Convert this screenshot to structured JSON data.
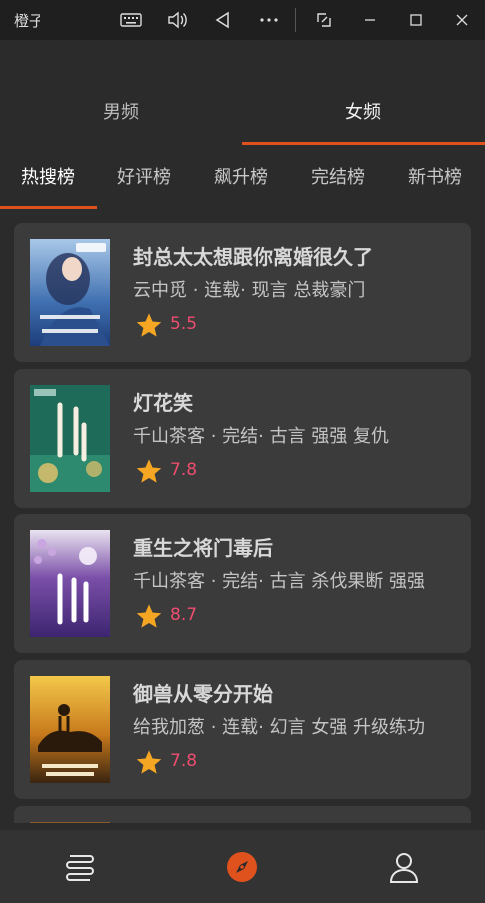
{
  "window": {
    "title": "橙子"
  },
  "titlebar_icons": [
    "keyboard-icon",
    "volume-icon",
    "back-triangle-icon",
    "more-icon",
    "screenshot-icon",
    "minimize-icon",
    "maximize-icon",
    "close-icon"
  ],
  "top_tabs": [
    {
      "label": "男频",
      "active": false
    },
    {
      "label": "女频",
      "active": true
    }
  ],
  "sub_tabs": [
    {
      "label": "热搜榜",
      "active": true
    },
    {
      "label": "好评榜",
      "active": false
    },
    {
      "label": "飙升榜",
      "active": false
    },
    {
      "label": "完结榜",
      "active": false
    },
    {
      "label": "新书榜",
      "active": false
    }
  ],
  "books": [
    {
      "title": "封总太太想跟你离婚很久了",
      "meta": "云中觅 · 连载· 现言 总裁豪门",
      "rating": "5.5"
    },
    {
      "title": "灯花笑",
      "meta": "千山茶客 · 完结· 古言 强强 复仇",
      "rating": "7.8"
    },
    {
      "title": "重生之将门毒后",
      "meta": "千山茶客 · 完结· 古言 杀伐果断 强强",
      "rating": "8.7"
    },
    {
      "title": "御兽从零分开始",
      "meta": "给我加葱 · 连载· 幻言 女强 升级练功",
      "rating": "7.8"
    }
  ],
  "colors": {
    "accent": "#e0521d",
    "rating": "#ee4d6f",
    "star": "#f5a623"
  },
  "bottom_nav": [
    "bookshelf-icon",
    "discover-compass-icon",
    "profile-icon"
  ]
}
